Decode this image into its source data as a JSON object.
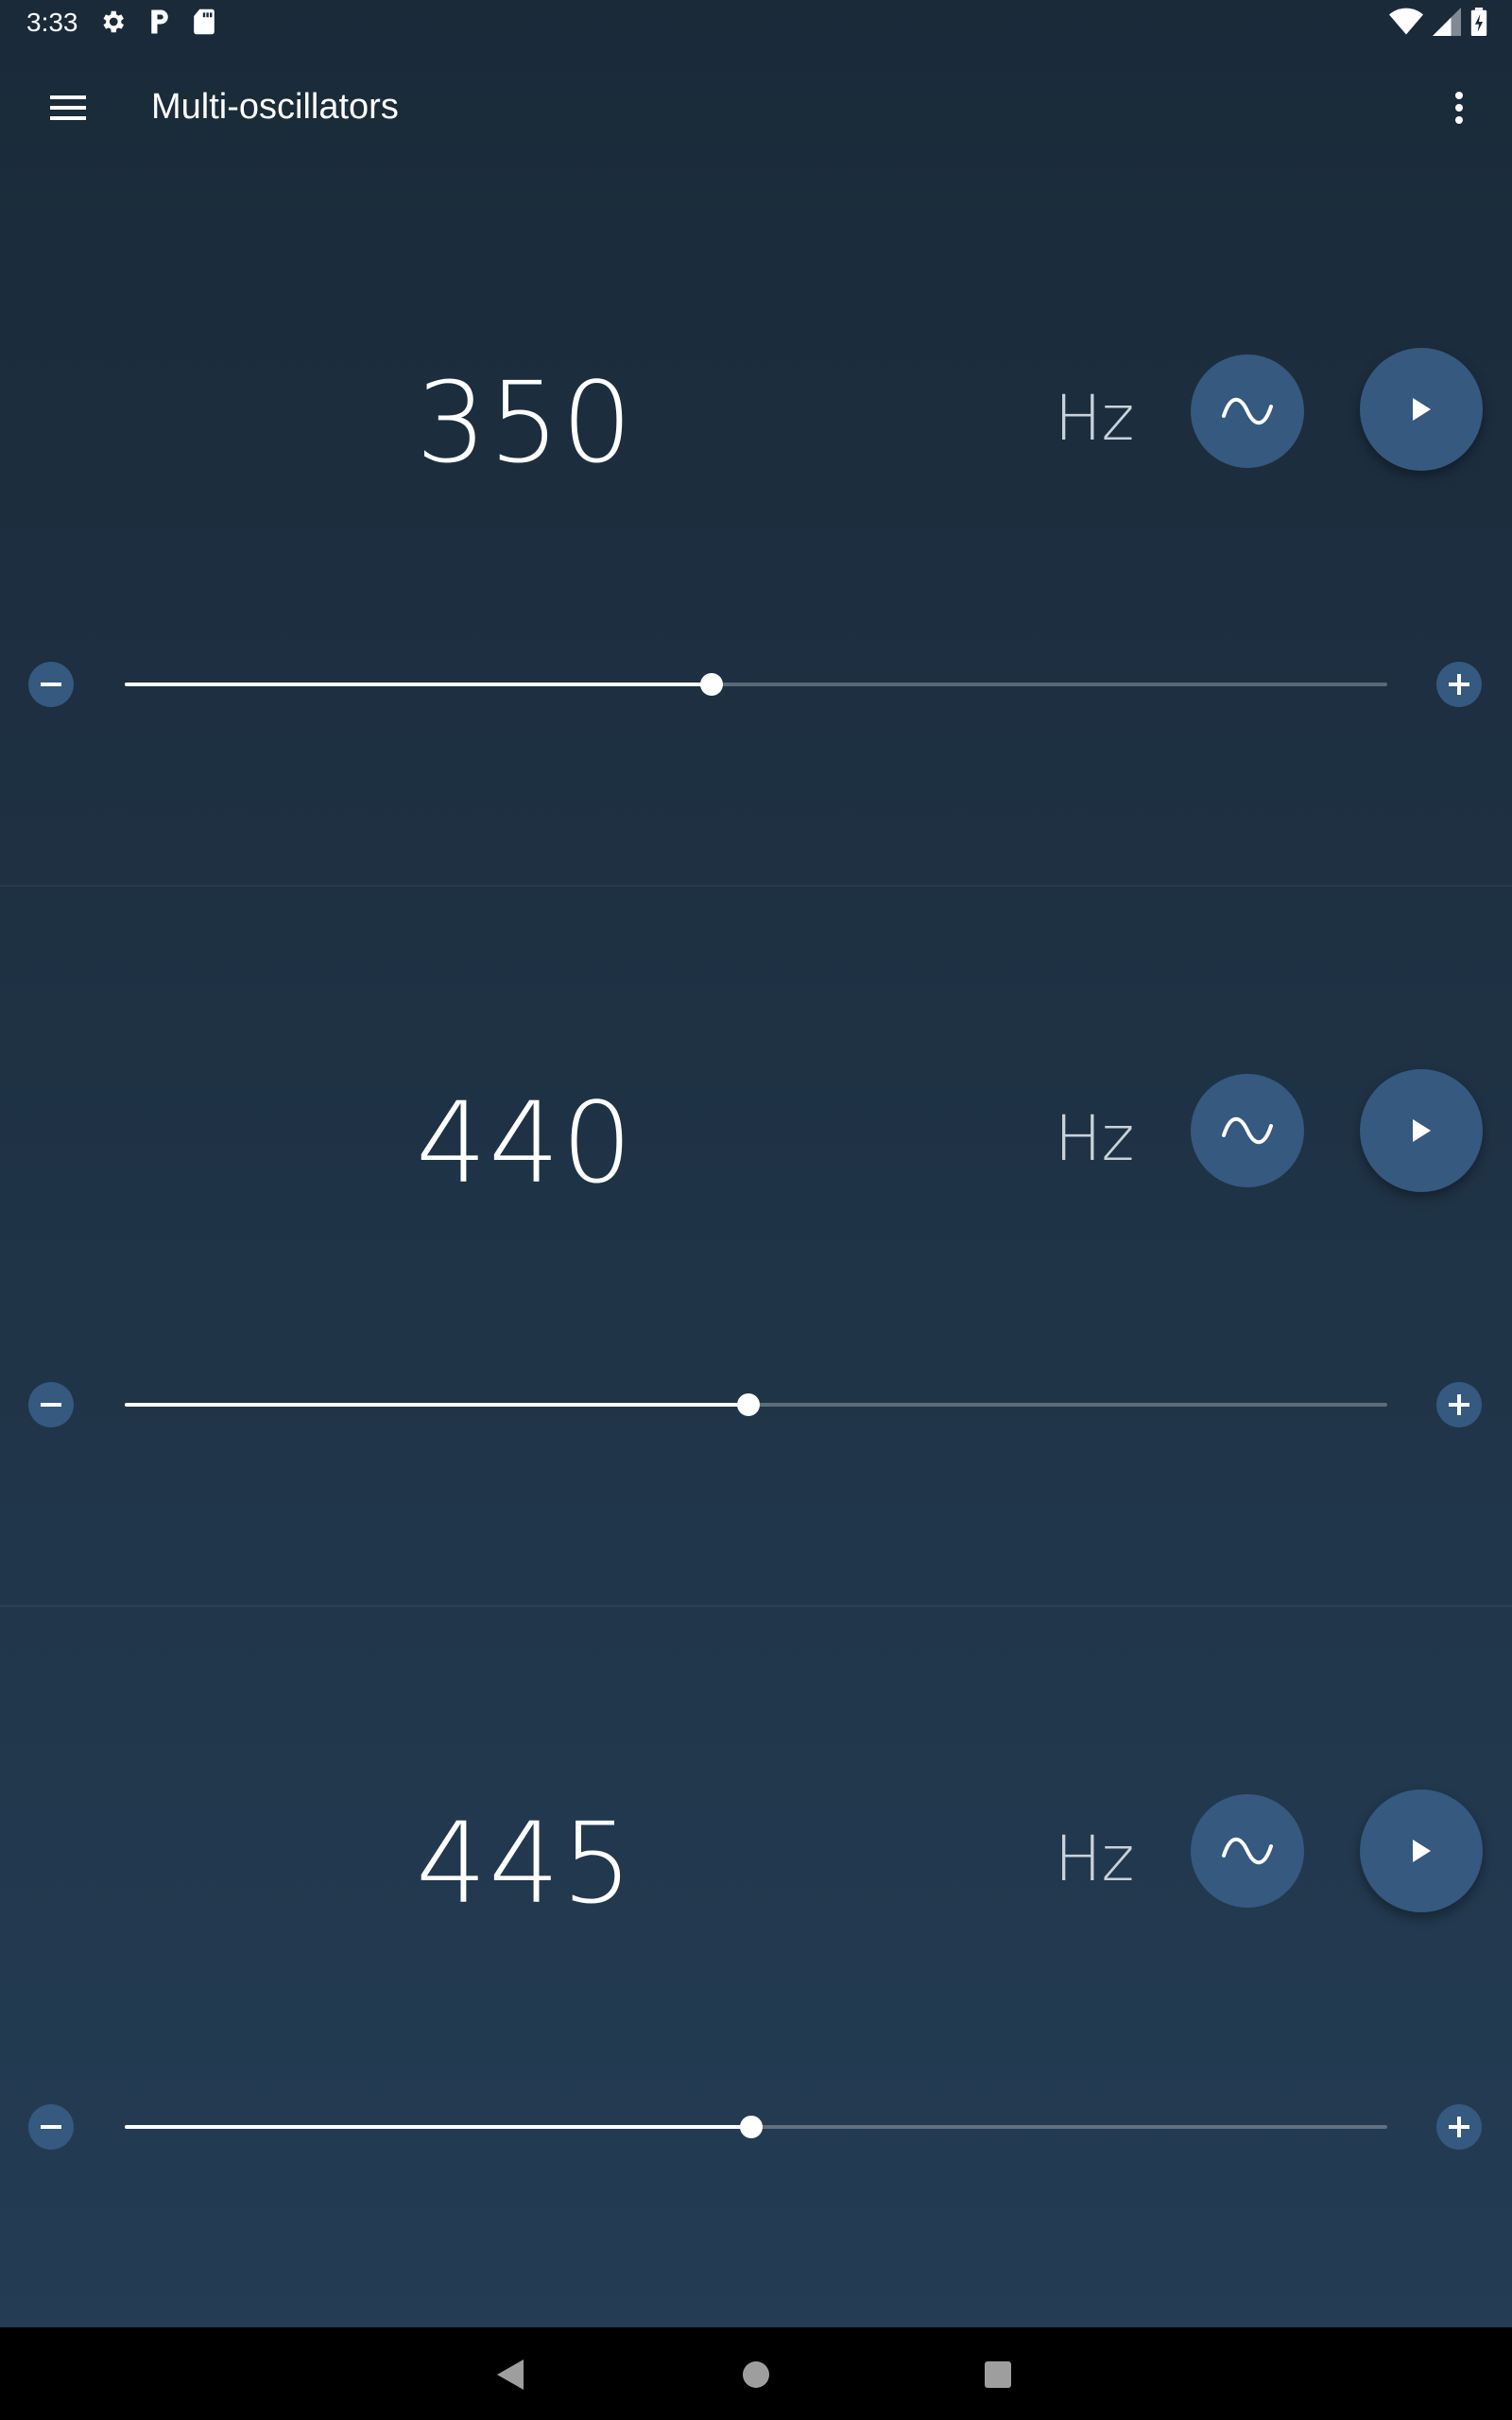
{
  "status_bar": {
    "time": "3:33",
    "left_icons": [
      "gear-icon",
      "parking-icon",
      "sd-card-icon"
    ],
    "right_icons": [
      "wifi-icon",
      "signal-icon",
      "battery-charging-icon"
    ]
  },
  "app_bar": {
    "title": "Multi-oscillators",
    "menu_icon": "hamburger-menu-icon",
    "overflow_icon": "more-vert-icon"
  },
  "oscillators": [
    {
      "frequency": "350",
      "unit": "Hz",
      "waveform_icon": "sine-wave-icon",
      "play_icon": "play-icon",
      "slider_level": 0.465
    },
    {
      "frequency": "440",
      "unit": "Hz",
      "waveform_icon": "sine-wave-icon",
      "play_icon": "play-icon",
      "slider_level": 0.494
    },
    {
      "frequency": "445",
      "unit": "Hz",
      "waveform_icon": "sine-wave-icon",
      "play_icon": "play-icon",
      "slider_level": 0.496
    }
  ],
  "nav_bar": {
    "icons": [
      "back-icon",
      "home-icon",
      "recents-icon"
    ]
  },
  "colors": {
    "background_top": "#1a2a39",
    "background_bottom": "#243d55",
    "button": "#35597f",
    "text": "#ffffff"
  }
}
